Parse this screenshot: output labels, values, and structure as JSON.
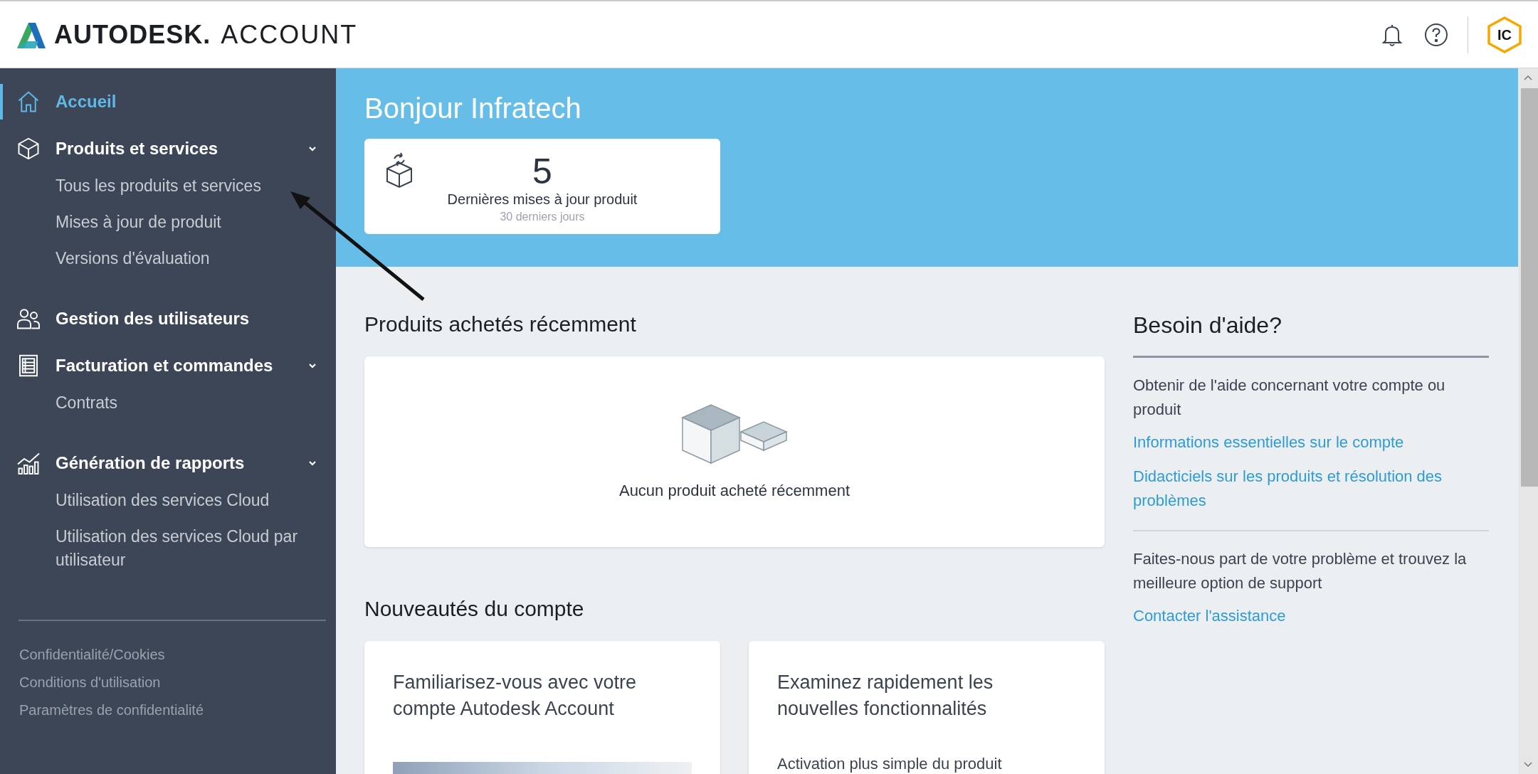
{
  "header": {
    "brand": "AUTODESK.",
    "product": "ACCOUNT",
    "avatar_initials": "IC"
  },
  "sidebar": {
    "items": [
      {
        "label": "Accueil",
        "selected": true
      },
      {
        "label": "Produits et services",
        "selected": false,
        "expanded": true,
        "children": [
          {
            "label": "Tous les produits et services"
          },
          {
            "label": "Mises à jour de produit"
          },
          {
            "label": "Versions d'évaluation"
          }
        ]
      },
      {
        "label": "Gestion des utilisateurs",
        "selected": false
      },
      {
        "label": "Facturation et commandes",
        "selected": false,
        "expanded": true,
        "children": [
          {
            "label": "Contrats"
          }
        ]
      },
      {
        "label": "Génération de rapports",
        "selected": false,
        "expanded": true,
        "children": [
          {
            "label": "Utilisation des services Cloud"
          },
          {
            "label": "Utilisation des services Cloud par utilisateur"
          }
        ]
      }
    ],
    "footer_links": [
      "Confidentialité/Cookies",
      "Conditions d'utilisation",
      "Paramètres de confidentialité"
    ]
  },
  "hero": {
    "greeting": "Bonjour Infratech",
    "stat": {
      "value": "5",
      "label": "Dernières mises à jour produit",
      "period": "30 derniers jours"
    }
  },
  "recent_purchases": {
    "title": "Produits achetés récemment",
    "empty_message": "Aucun produit acheté récemment"
  },
  "news": {
    "title": "Nouveautés du compte",
    "cards": [
      {
        "title": "Familiarisez-vous avec votre compte Autodesk Account",
        "kind": "image"
      },
      {
        "title": "Examinez rapidement les nouvelles fonctionnalités",
        "kind": "text",
        "text": "Activation plus simple du produit"
      }
    ]
  },
  "help": {
    "title": "Besoin d'aide?",
    "sections": [
      {
        "text": "Obtenir de l'aide concernant votre compte ou produit",
        "links": [
          "Informations essentielles sur le compte",
          "Didacticiels sur les produits et résolution des problèmes"
        ]
      },
      {
        "text": "Faites-nous part de votre problème et trouvez la meilleure option de support",
        "links": [
          "Contacter l'assistance"
        ]
      }
    ]
  }
}
